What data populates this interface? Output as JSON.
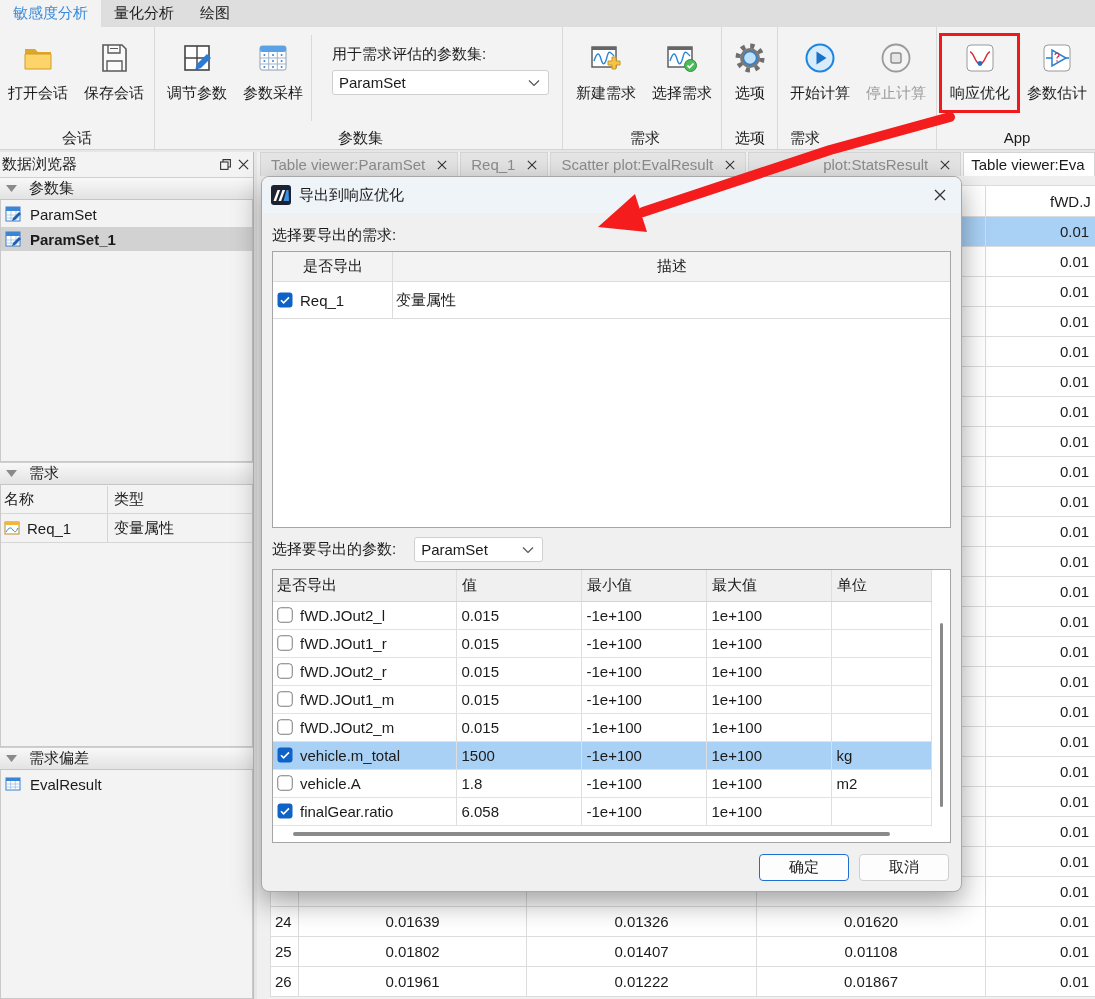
{
  "ribbon_tabs": [
    {
      "label": "敏感度分析",
      "selected": true
    },
    {
      "label": "量化分析",
      "selected": false
    },
    {
      "label": "绘图",
      "selected": false
    }
  ],
  "ribbon_groups": [
    {
      "label": "会话",
      "items": [
        {
          "kind": "button",
          "label": "打开会话",
          "disabled": false,
          "highlighted": false
        },
        {
          "kind": "button",
          "label": "保存会话",
          "disabled": false,
          "highlighted": false
        }
      ]
    },
    {
      "label": "参数集",
      "items": [
        {
          "kind": "button",
          "label": "调节参数",
          "disabled": false,
          "highlighted": false
        },
        {
          "kind": "button",
          "label": "参数采样",
          "disabled": false,
          "highlighted": false
        },
        {
          "kind": "dropdown",
          "label": "用于需求评估的参数集:",
          "value": "ParamSet"
        }
      ]
    },
    {
      "label": "需求",
      "items": [
        {
          "kind": "button",
          "label": "新建需求",
          "disabled": false,
          "highlighted": false
        },
        {
          "kind": "button",
          "label": "选择需求",
          "disabled": false,
          "highlighted": false
        }
      ]
    },
    {
      "label": "选项",
      "items": [
        {
          "kind": "button",
          "label": "选项",
          "disabled": false,
          "highlighted": false
        }
      ]
    },
    {
      "label": "需求",
      "items": [
        {
          "kind": "button",
          "label": "开始计算",
          "disabled": false,
          "highlighted": false
        },
        {
          "kind": "button",
          "label": "停止计算",
          "disabled": true,
          "highlighted": false
        }
      ]
    },
    {
      "label": "App",
      "items": [
        {
          "kind": "button",
          "label": "响应优化",
          "disabled": false,
          "highlighted": true
        },
        {
          "kind": "button",
          "label": "参数估计",
          "disabled": false,
          "highlighted": false
        }
      ]
    }
  ],
  "data_browser": {
    "title": "数据浏览器",
    "sections": [
      {
        "kind": "list",
        "title": "参数集",
        "expanded": true,
        "items": [
          {
            "label": "ParamSet",
            "selected": false
          },
          {
            "label": "ParamSet_1",
            "selected": true
          }
        ]
      },
      {
        "kind": "table",
        "title": "需求",
        "expanded": true,
        "columns": [
          "名称",
          "类型"
        ],
        "rows": [
          {
            "selected": false,
            "cells": [
              "Req_1",
              "变量属性"
            ]
          }
        ]
      },
      {
        "kind": "list",
        "title": "需求偏差",
        "expanded": true,
        "items": [
          {
            "label": "EvalResult",
            "selected": false
          }
        ]
      }
    ]
  },
  "document_tabs": [
    {
      "label": "Table viewer:ParamSet",
      "selected": false,
      "closable": true
    },
    {
      "label": "Req_1",
      "selected": false,
      "closable": true
    },
    {
      "label": "Scatter plot:EvalResult",
      "selected": false,
      "closable": true
    },
    {
      "label": "plot:StatsResult",
      "selected": false,
      "closable": true
    },
    {
      "label": "Table viewer:Eva",
      "selected": true,
      "closable": false
    }
  ],
  "result_table": {
    "column_5_header": "fWD.J",
    "rows": [
      {
        "selected": true,
        "column_5": "0.01"
      },
      {
        "selected": false,
        "column_5": "0.01"
      },
      {
        "selected": false,
        "column_5": "0.01"
      },
      {
        "selected": false,
        "column_5": "0.01"
      },
      {
        "selected": false,
        "column_5": "0.01"
      },
      {
        "selected": false,
        "column_5": "0.01"
      },
      {
        "selected": false,
        "column_5": "0.01"
      },
      {
        "selected": false,
        "column_5": "0.01"
      },
      {
        "selected": false,
        "column_5": "0.01"
      },
      {
        "selected": false,
        "column_5": "0.01"
      },
      {
        "selected": false,
        "column_5": "0.01"
      },
      {
        "selected": false,
        "column_5": "0.01"
      },
      {
        "selected": false,
        "column_5": "0.01"
      },
      {
        "selected": false,
        "column_5": "0.01"
      },
      {
        "selected": false,
        "column_5": "0.01"
      },
      {
        "selected": false,
        "column_5": "0.01"
      },
      {
        "selected": false,
        "column_5": "0.01"
      },
      {
        "selected": false,
        "column_5": "0.01"
      },
      {
        "selected": false,
        "column_5": "0.01"
      },
      {
        "selected": false,
        "column_5": "0.01"
      },
      {
        "selected": false,
        "column_5": "0.01"
      },
      {
        "selected": false,
        "column_5": "0.01"
      },
      {
        "selected": false,
        "column_5": "0.01"
      },
      {
        "selected": false,
        "number": "24",
        "column_2": "0.01639",
        "column_3": "0.01326",
        "column_4": "0.01620",
        "column_5": "0.01"
      },
      {
        "selected": false,
        "number": "25",
        "column_2": "0.01802",
        "column_3": "0.01407",
        "column_4": "0.01108",
        "column_5": "0.01"
      },
      {
        "selected": false,
        "number": "26",
        "column_2": "0.01961",
        "column_3": "0.01222",
        "column_4": "0.01867",
        "column_5": "0.01"
      }
    ]
  },
  "dialog": {
    "title": "导出到响应优化",
    "requirements_label": "选择要导出的需求:",
    "requirements_table": {
      "columns": [
        "是否导出",
        "描述"
      ],
      "rows": [
        {
          "checked": true,
          "name": "Req_1",
          "description": "变量属性"
        }
      ]
    },
    "parameters_label": "选择要导出的参数:",
    "parameter_set": "ParamSet",
    "parameters_table": {
      "columns": [
        "是否导出",
        "值",
        "最小值",
        "最大值",
        "单位"
      ],
      "rows": [
        {
          "checked": false,
          "selected": false,
          "name": "fWD.JOut2_l",
          "value": "0.015",
          "min": "-1e+100",
          "max": "1e+100"
        },
        {
          "checked": false,
          "selected": false,
          "name": "fWD.JOut1_r",
          "value": "0.015",
          "min": "-1e+100",
          "max": "1e+100"
        },
        {
          "checked": false,
          "selected": false,
          "name": "fWD.JOut2_r",
          "value": "0.015",
          "min": "-1e+100",
          "max": "1e+100"
        },
        {
          "checked": false,
          "selected": false,
          "name": "fWD.JOut1_m",
          "value": "0.015",
          "min": "-1e+100",
          "max": "1e+100"
        },
        {
          "checked": false,
          "selected": false,
          "name": "fWD.JOut2_m",
          "value": "0.015",
          "min": "-1e+100",
          "max": "1e+100"
        },
        {
          "checked": true,
          "selected": true,
          "name": "vehicle.m_total",
          "value": "1500",
          "min": "-1e+100",
          "max": "1e+100",
          "unit": "kg"
        },
        {
          "checked": false,
          "selected": false,
          "name": "vehicle.A",
          "value": "1.8",
          "min": "-1e+100",
          "max": "1e+100",
          "unit": "m2"
        },
        {
          "checked": true,
          "selected": false,
          "name": "finalGear.ratio",
          "value": "6.058",
          "min": "-1e+100",
          "max": "1e+100"
        }
      ]
    },
    "buttons": [
      {
        "label": "确定",
        "default": true
      },
      {
        "label": "取消",
        "default": false
      }
    ]
  }
}
